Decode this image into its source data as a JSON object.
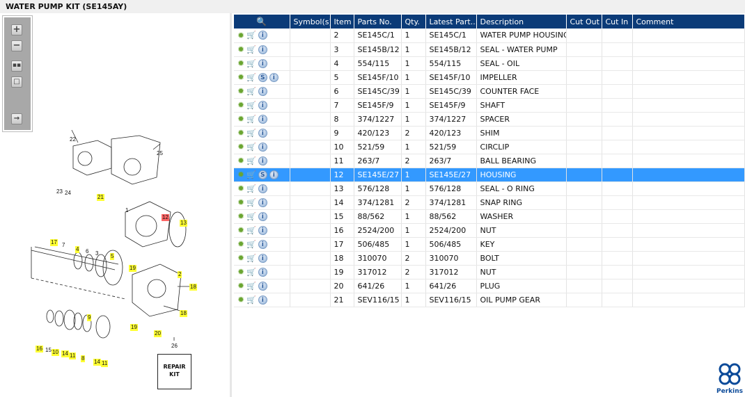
{
  "title": "WATER PUMP KIT (SE145AY)",
  "toolbar": {
    "zoom_in": "+",
    "zoom_out": "−"
  },
  "diagram": {
    "callouts": [
      "22",
      "25",
      "23",
      "24",
      "21",
      "1",
      "12",
      "13",
      "17",
      "7",
      "4",
      "6",
      "3",
      "5",
      "19",
      "2",
      "18",
      "18",
      "19",
      "20",
      "9",
      "16",
      "15",
      "10",
      "14",
      "11",
      "8",
      "14",
      "11",
      "26"
    ],
    "kit_label_1": "REPAIR",
    "kit_label_2": "KIT"
  },
  "table": {
    "headers": [
      "",
      "Symbol(s)",
      "Item",
      "Parts No.",
      "Qty.",
      "Latest Part...",
      "Description",
      "Cut Out",
      "Cut In",
      "Comment"
    ],
    "rows": [
      {
        "item": "2",
        "part": "SE145C/1",
        "qty": "1",
        "latest": "SE145C/1",
        "desc": "WATER PUMP HOUSING",
        "s": false
      },
      {
        "item": "3",
        "part": "SE145B/12",
        "qty": "1",
        "latest": "SE145B/12",
        "desc": "SEAL - WATER PUMP",
        "s": false
      },
      {
        "item": "4",
        "part": "554/115",
        "qty": "1",
        "latest": "554/115",
        "desc": "SEAL - OIL",
        "s": false
      },
      {
        "item": "5",
        "part": "SE145F/10",
        "qty": "1",
        "latest": "SE145F/10",
        "desc": "IMPELLER",
        "s": true
      },
      {
        "item": "6",
        "part": "SE145C/39",
        "qty": "1",
        "latest": "SE145C/39",
        "desc": "COUNTER FACE",
        "s": false
      },
      {
        "item": "7",
        "part": "SE145F/9",
        "qty": "1",
        "latest": "SE145F/9",
        "desc": "SHAFT",
        "s": false
      },
      {
        "item": "8",
        "part": "374/1227",
        "qty": "1",
        "latest": "374/1227",
        "desc": "SPACER",
        "s": false
      },
      {
        "item": "9",
        "part": "420/123",
        "qty": "2",
        "latest": "420/123",
        "desc": "SHIM",
        "s": false
      },
      {
        "item": "10",
        "part": "521/59",
        "qty": "1",
        "latest": "521/59",
        "desc": "CIRCLIP",
        "s": false
      },
      {
        "item": "11",
        "part": "263/7",
        "qty": "2",
        "latest": "263/7",
        "desc": "BALL BEARING",
        "s": false
      },
      {
        "item": "12",
        "part": "SE145E/27",
        "qty": "1",
        "latest": "SE145E/27",
        "desc": "HOUSING",
        "s": true,
        "selected": true
      },
      {
        "item": "13",
        "part": "576/128",
        "qty": "1",
        "latest": "576/128",
        "desc": "SEAL - O RING",
        "s": false
      },
      {
        "item": "14",
        "part": "374/1281",
        "qty": "2",
        "latest": "374/1281",
        "desc": "SNAP RING",
        "s": false
      },
      {
        "item": "15",
        "part": "88/562",
        "qty": "1",
        "latest": "88/562",
        "desc": "WASHER",
        "s": false
      },
      {
        "item": "16",
        "part": "2524/200",
        "qty": "1",
        "latest": "2524/200",
        "desc": "NUT",
        "s": false
      },
      {
        "item": "17",
        "part": "506/485",
        "qty": "1",
        "latest": "506/485",
        "desc": "KEY",
        "s": false
      },
      {
        "item": "18",
        "part": "310070",
        "qty": "2",
        "latest": "310070",
        "desc": "BOLT",
        "s": false
      },
      {
        "item": "19",
        "part": "317012",
        "qty": "2",
        "latest": "317012",
        "desc": "NUT",
        "s": false
      },
      {
        "item": "20",
        "part": "641/26",
        "qty": "1",
        "latest": "641/26",
        "desc": "PLUG",
        "s": false
      },
      {
        "item": "21",
        "part": "SEV116/15",
        "qty": "1",
        "latest": "SEV116/15",
        "desc": "OIL PUMP GEAR",
        "s": false
      }
    ],
    "s_symbol": "S",
    "info_symbol": "i"
  },
  "logo": {
    "text": "Perkins"
  },
  "colors": {
    "header": "#0b3b78",
    "selected": "#3399ff",
    "callout": "#ffff33",
    "callout_selected": "#ff6666"
  }
}
